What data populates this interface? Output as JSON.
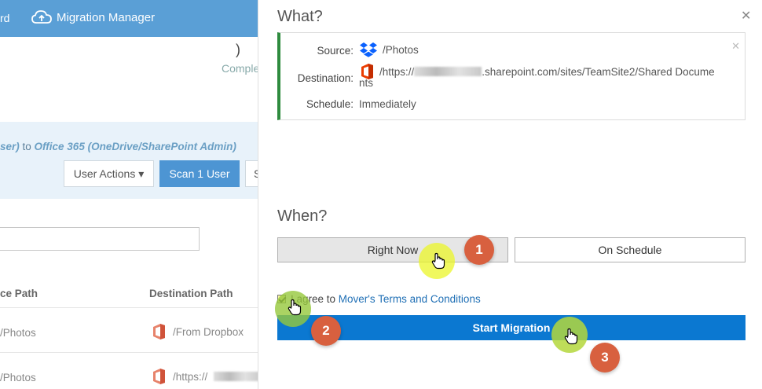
{
  "background": {
    "nav_fragment": "rd",
    "app_title": "Migration Manager",
    "glyph": ")",
    "status_fragment": "Comple",
    "banner": {
      "prefix": "ser)",
      "connector": " to ",
      "target": "Office 365 (OneDrive/SharePoint Admin)"
    },
    "user_actions_label": "User Actions ▾",
    "scan_label": "Scan 1 User",
    "s_fragment": "S",
    "columns": {
      "source": "ce Path",
      "destination": "Destination Path"
    },
    "rows": [
      {
        "source": "/Photos",
        "destination": "/From Dropbox"
      },
      {
        "source": "/Photos",
        "destination": "/https://"
      }
    ]
  },
  "panel": {
    "what_heading": "What?",
    "summary": {
      "source_label": "Source:",
      "source_value": "/Photos",
      "destination_label": "Destination:",
      "destination_prefix": "/https://",
      "destination_suffix": ".sharepoint.com/sites/TeamSite2/Shared Docume",
      "destination_tail": "nts",
      "schedule_label": "Schedule:",
      "schedule_value": "Immediately"
    },
    "when_heading": "When?",
    "right_now_label": "Right Now",
    "on_schedule_label": "On Schedule",
    "agree_prefix": "I agree to ",
    "terms_link": "Mover's Terms and Conditions",
    "start_label": "Start Migration"
  },
  "steps": [
    "1",
    "2",
    "3"
  ],
  "icons": [
    "cloud-upload-icon",
    "dropbox-icon",
    "office365-icon",
    "close-icon",
    "hand-cursor-icon"
  ],
  "colors": {
    "topbar": "#5a9fd6",
    "primary_button": "#0b78d1",
    "success_border": "#2e8b3e",
    "step_badge": "#d8603f",
    "highlight": "#ebf528"
  }
}
